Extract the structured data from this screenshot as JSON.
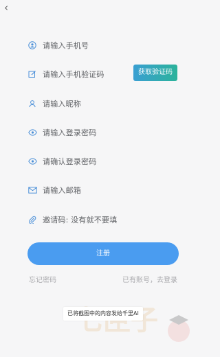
{
  "nav": {
    "back_icon": "chevron-left-icon"
  },
  "form": {
    "phone_placeholder": "请输入手机号",
    "code_placeholder": "请输入手机验证码",
    "get_code_label": "获取验证码",
    "nickname_placeholder": "请输入昵称",
    "password_placeholder": "请输入登录密码",
    "confirm_password_placeholder": "请确认登录密码",
    "email_placeholder": "请输入邮箱",
    "invite_placeholder": "邀请码: 没有就不要填"
  },
  "actions": {
    "register_label": "注册",
    "forgot_password_label": "忘记密码",
    "have_account_label": "已有账号，去登录"
  },
  "toast": {
    "text": "已将截图中的内容发给千里AI"
  },
  "watermark": {
    "text": "七匣子"
  },
  "colors": {
    "primary": "#4a9cf0",
    "code_gradient_start": "#3a9fd2",
    "code_gradient_end": "#2bb39b",
    "icon_blue": "#4a8fd8",
    "background": "#f6f6f7"
  }
}
